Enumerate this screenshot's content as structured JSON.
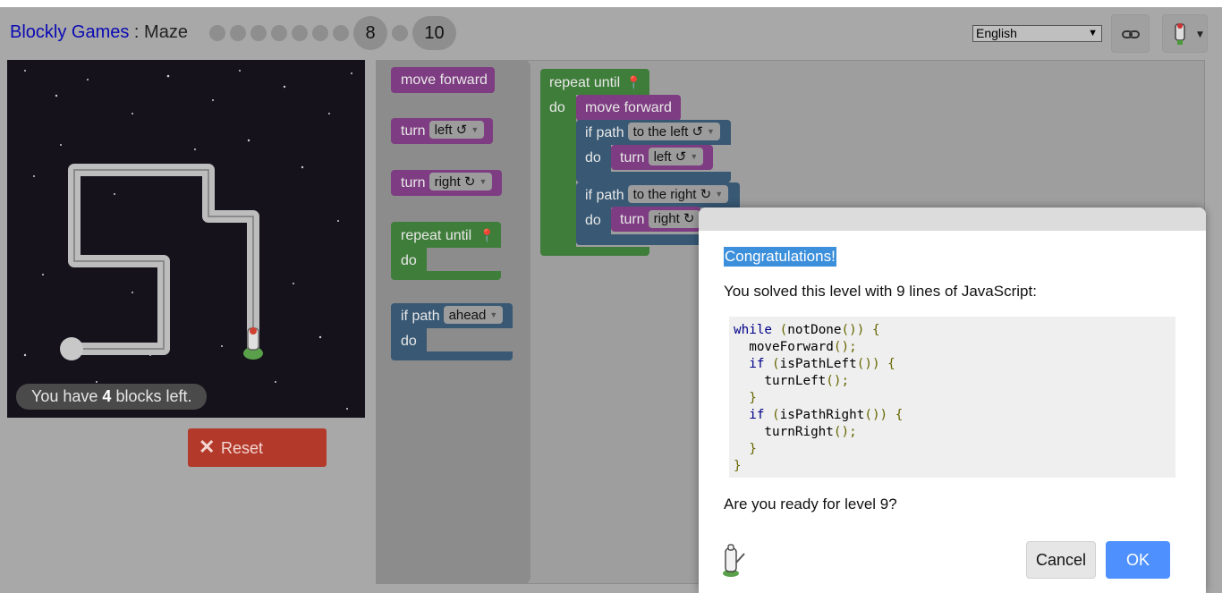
{
  "header": {
    "app_name": "Blockly Games",
    "separator": " : ",
    "game_name": "Maze",
    "current_level": "8",
    "last_level": "10",
    "language": "English"
  },
  "maze": {
    "blocks_left_prefix": "You have ",
    "blocks_left_count": "4",
    "blocks_left_suffix": " blocks left.",
    "reset_label": "Reset"
  },
  "toolbox": {
    "move_forward": "move forward",
    "turn": "turn",
    "left": "left ↺",
    "right": "right ↻",
    "repeat_until": "repeat until",
    "do": "do",
    "if_path": "if path",
    "ahead": "ahead"
  },
  "program": {
    "repeat_until": "repeat until",
    "do": "do",
    "move_forward": "move forward",
    "if_path": "if path",
    "to_the_left": "to the left ↺",
    "to_the_right": "to the right ↻",
    "turn": "turn",
    "left": "left ↺",
    "right": "right ↻"
  },
  "dialog": {
    "title": "Congratulations!",
    "message": "You solved this level with 9 lines of JavaScript:",
    "question": "Are you ready for level 9?",
    "cancel_label": "Cancel",
    "ok_label": "OK"
  },
  "colors": {
    "move_block": "#7e3d82",
    "loop_block": "#3f7d3a",
    "logic_block": "#385874",
    "ok_button": "#4d90fe",
    "reset_button": "#b33a2b"
  }
}
